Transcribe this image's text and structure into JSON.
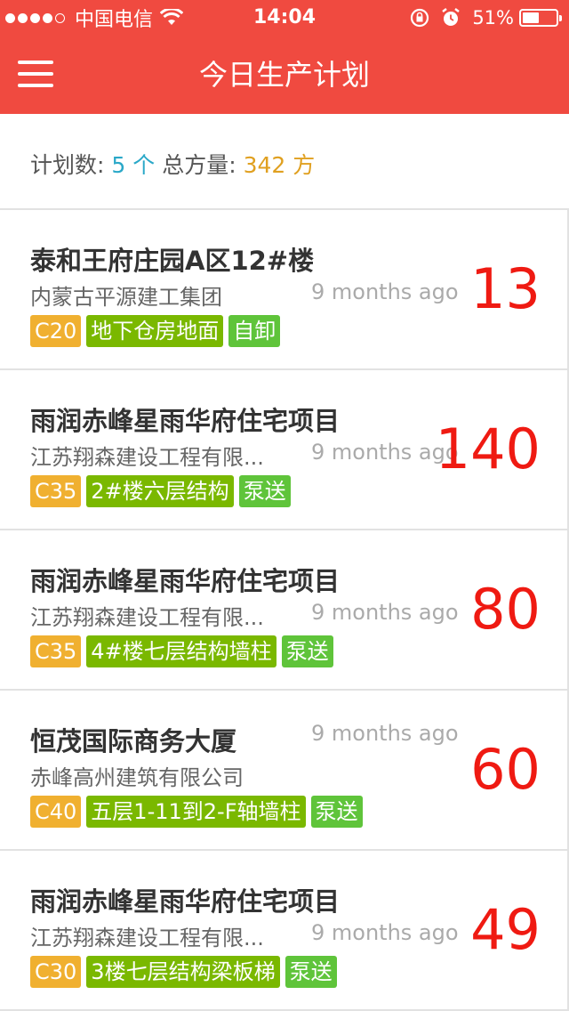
{
  "status_bar": {
    "carrier": "中国电信",
    "time": "14:04",
    "battery_percent": "51%",
    "battery_level": 0.51,
    "signal_dots": 5,
    "signal_filled": 4
  },
  "header": {
    "title": "今日生产计划",
    "menu_icon": "hamburger-icon",
    "background": "#f04a40"
  },
  "summary": {
    "plan_label": "计划数:",
    "plan_count": "5 个",
    "volume_label": "总方量:",
    "volume_value": "342 方"
  },
  "plans": [
    {
      "project": "泰和王府庄园A区12#楼",
      "company": "内蒙古平源建工集团",
      "time": "9 months ago",
      "quantity": "13",
      "grade": "C20",
      "part": "地下仓房地面",
      "method": "自卸"
    },
    {
      "project": "雨润赤峰星雨华府住宅项目",
      "company": "江苏翔森建设工程有限...",
      "time": "9 months ago",
      "quantity": "140",
      "grade": "C35",
      "part": "2#楼六层结构",
      "method": "泵送"
    },
    {
      "project": "雨润赤峰星雨华府住宅项目",
      "company": "江苏翔森建设工程有限...",
      "time": "9 months ago",
      "quantity": "80",
      "grade": "C35",
      "part": "4#楼七层结构墙柱",
      "method": "泵送"
    },
    {
      "project": "恒茂国际商务大厦",
      "company": "赤峰高州建筑有限公司",
      "time": "9 months ago",
      "quantity": "60",
      "grade": "C40",
      "part": "五层1-11到2-F轴墙柱",
      "method": "泵送"
    },
    {
      "project": "雨润赤峰星雨华府住宅项目",
      "company": "江苏翔森建设工程有限...",
      "time": "9 months ago",
      "quantity": "49",
      "grade": "C30",
      "part": "3楼七层结构梁板梯",
      "method": "泵送"
    }
  ]
}
